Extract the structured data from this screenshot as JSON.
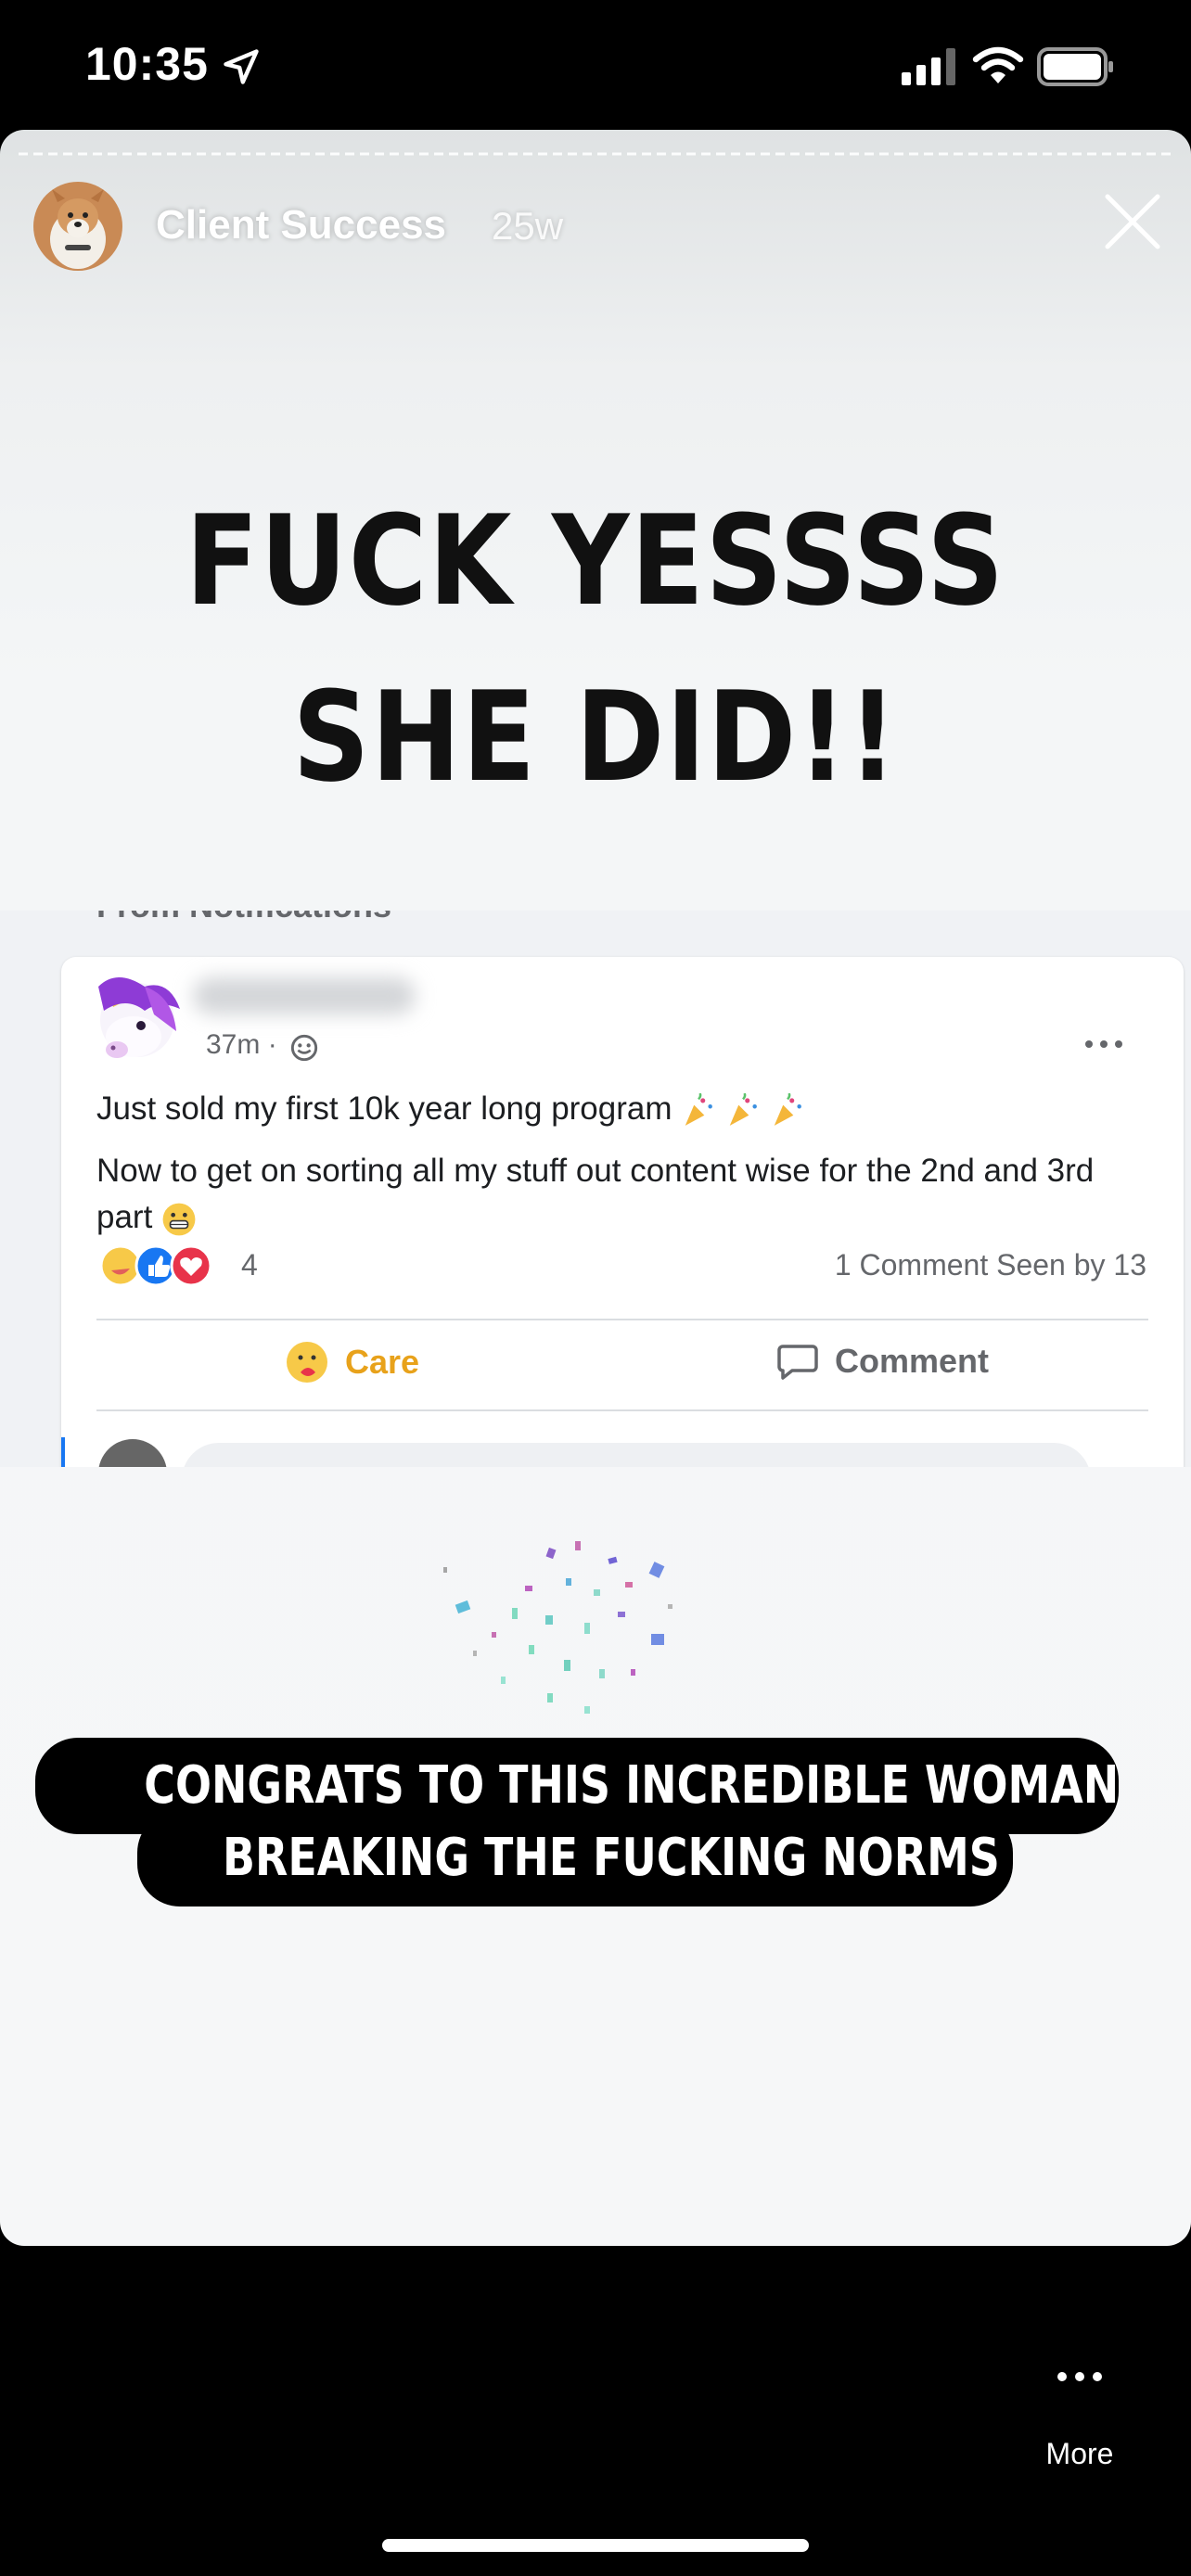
{
  "status_bar": {
    "time": "10:35"
  },
  "story": {
    "user": "Client Success",
    "age": "25w",
    "headline_lines": [
      "FUCK YESSSS",
      "SHE DID!!"
    ],
    "caption_lines": [
      "CONGRATS TO THIS INCREDIBLE WOMAN.",
      "BREAKING THE FUCKING NORMS"
    ]
  },
  "post": {
    "header_fragment": "From Notifications",
    "time": "37m ·",
    "text1": "Just sold my first 10k year long program",
    "text2": "Now to get on sorting all my stuff out content wise for the 2nd and 3rd part",
    "reaction_count": "4",
    "stats": "1 Comment  Seen by 13",
    "care_label": "Care",
    "comment_label": "Comment"
  },
  "more": {
    "label": "More"
  },
  "colors": {
    "care": "#e8a21b",
    "fb_blue": "#1877f2",
    "story_bg": "#f4f6f7"
  }
}
